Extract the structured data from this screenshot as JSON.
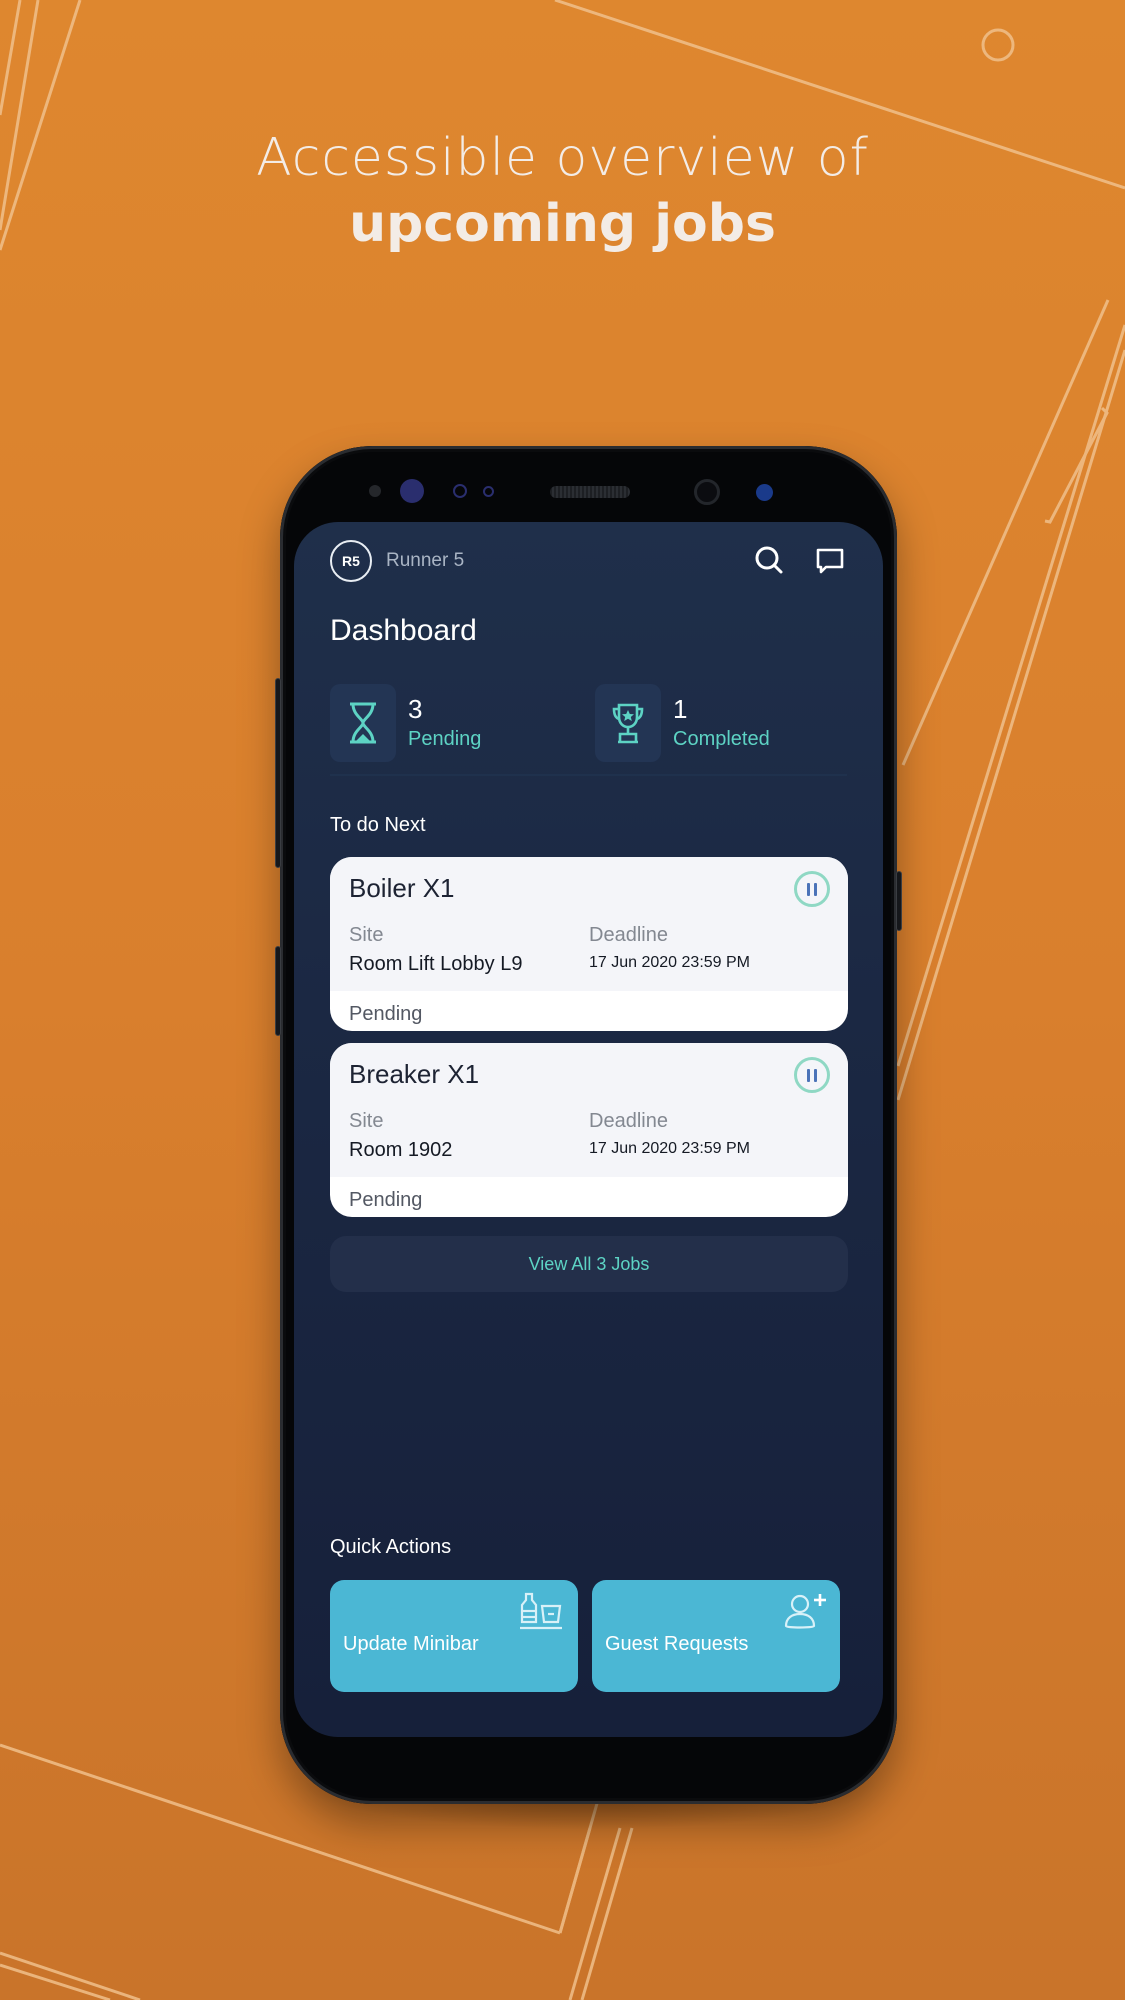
{
  "marketing": {
    "headline_line1": "Accessible overview of",
    "headline_line2": "upcoming jobs",
    "background_color": "#d9822e",
    "line_color": "#f0c08b"
  },
  "app": {
    "header": {
      "avatar_initials": "R5",
      "user_name": "Runner 5",
      "search_icon": "search-icon",
      "messages_icon": "chat-bubble-icon"
    },
    "page_title": "Dashboard",
    "stats": [
      {
        "icon": "hourglass-icon",
        "count": "3",
        "label": "Pending"
      },
      {
        "icon": "trophy-icon",
        "count": "1",
        "label": "Completed"
      }
    ],
    "todo": {
      "section_label": "To do Next",
      "jobs": [
        {
          "title": "Boiler X1",
          "site_label": "Site",
          "site": "Room Lift Lobby L9",
          "deadline_label": "Deadline",
          "deadline": "17 Jun 2020 23:59 PM",
          "status": "Pending",
          "action_icon": "pause-icon"
        },
        {
          "title": "Breaker X1",
          "site_label": "Site",
          "site": "Room 1902",
          "deadline_label": "Deadline",
          "deadline": "17 Jun 2020 23:59 PM",
          "status": "Pending",
          "action_icon": "pause-icon"
        }
      ],
      "view_all_label": "View All 3 Jobs"
    },
    "quick_actions": {
      "section_label": "Quick Actions",
      "items": [
        {
          "label": "Update Minibar",
          "icon": "minibar-icon"
        },
        {
          "label": "Guest Requests",
          "icon": "add-user-icon"
        }
      ]
    },
    "colors": {
      "screen_bg": "#1c2a45",
      "accent_teal": "#5dd3c4",
      "quick_action_bg": "#4bb7d4",
      "card_bg": "#f4f5f9"
    }
  }
}
